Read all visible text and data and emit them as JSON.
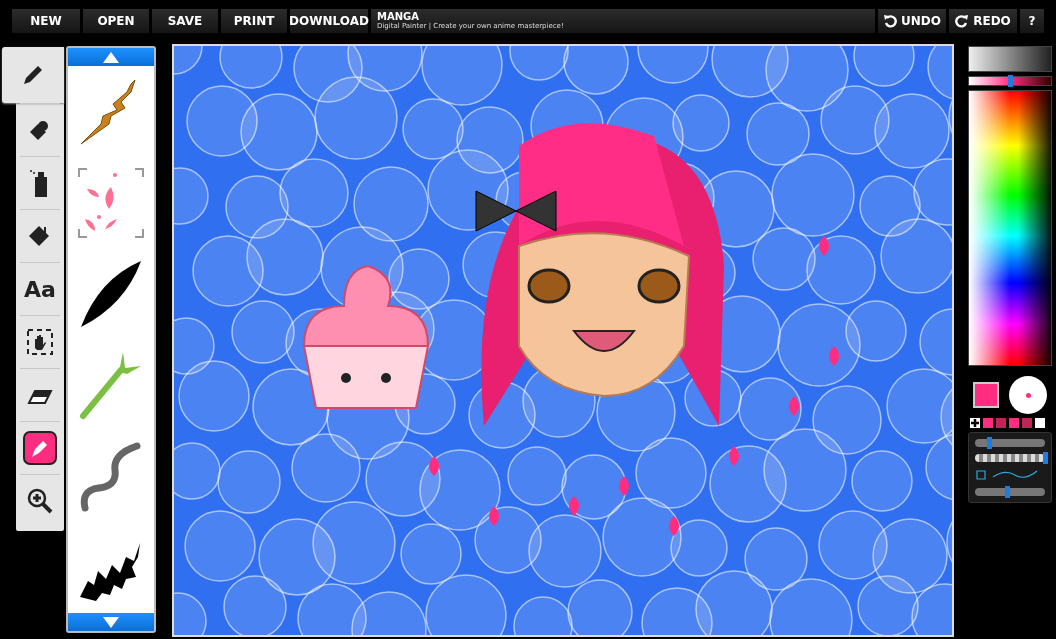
{
  "menu": [
    {
      "label": "NEW"
    },
    {
      "label": "OPEN"
    },
    {
      "label": "SAVE"
    },
    {
      "label": "PRINT"
    },
    {
      "label": "DOWNLOAD"
    }
  ],
  "app": {
    "title": "MANGA",
    "subtitle": "Digital Painter | Create your own anime masterpiece!"
  },
  "history": [
    {
      "kind": "undo",
      "label": "UNDO"
    },
    {
      "kind": "redo",
      "label": "REDO"
    }
  ],
  "help": {
    "label": "?"
  },
  "tools": [
    {
      "kind": "pencil",
      "selected": true
    },
    {
      "kind": "stamp",
      "selected": false
    },
    {
      "kind": "spray",
      "selected": false
    },
    {
      "kind": "fill",
      "selected": false
    },
    {
      "kind": "text",
      "label": "Aa",
      "selected": false
    },
    {
      "kind": "move",
      "selected": false
    },
    {
      "kind": "eraser",
      "selected": false
    },
    {
      "kind": "dropper",
      "selected": false
    },
    {
      "kind": "zoom",
      "selected": false
    }
  ],
  "brushes": [
    {
      "kind": "branch"
    },
    {
      "kind": "petals"
    },
    {
      "kind": "leaf"
    },
    {
      "kind": "bamboo"
    },
    {
      "kind": "rope"
    },
    {
      "kind": "flame"
    }
  ],
  "colors": {
    "shade": {
      "level": 0.5
    },
    "current": {
      "color": "#ff2d7f"
    },
    "swatches": [
      {
        "color": "#ff2d7f"
      },
      {
        "color": "#c0245a"
      },
      {
        "color": "#ff2d7f"
      },
      {
        "color": "#c0245a"
      },
      {
        "color": "#ffffff"
      }
    ]
  },
  "brush_settings": {
    "size": {
      "level": 0.2
    },
    "opacity": {
      "level": 1.0
    },
    "smoothing": {
      "level": 0.46
    }
  }
}
